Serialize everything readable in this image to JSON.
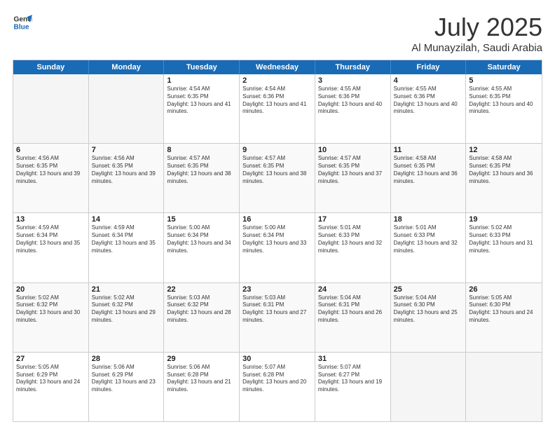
{
  "header": {
    "logo_line1": "General",
    "logo_line2": "Blue",
    "month": "July 2025",
    "location": "Al Munayzilah, Saudi Arabia"
  },
  "weekdays": [
    "Sunday",
    "Monday",
    "Tuesday",
    "Wednesday",
    "Thursday",
    "Friday",
    "Saturday"
  ],
  "rows": [
    [
      {
        "day": "",
        "sunrise": "",
        "sunset": "",
        "daylight": ""
      },
      {
        "day": "",
        "sunrise": "",
        "sunset": "",
        "daylight": ""
      },
      {
        "day": "1",
        "sunrise": "Sunrise: 4:54 AM",
        "sunset": "Sunset: 6:35 PM",
        "daylight": "Daylight: 13 hours and 41 minutes."
      },
      {
        "day": "2",
        "sunrise": "Sunrise: 4:54 AM",
        "sunset": "Sunset: 6:36 PM",
        "daylight": "Daylight: 13 hours and 41 minutes."
      },
      {
        "day": "3",
        "sunrise": "Sunrise: 4:55 AM",
        "sunset": "Sunset: 6:36 PM",
        "daylight": "Daylight: 13 hours and 40 minutes."
      },
      {
        "day": "4",
        "sunrise": "Sunrise: 4:55 AM",
        "sunset": "Sunset: 6:36 PM",
        "daylight": "Daylight: 13 hours and 40 minutes."
      },
      {
        "day": "5",
        "sunrise": "Sunrise: 4:55 AM",
        "sunset": "Sunset: 6:35 PM",
        "daylight": "Daylight: 13 hours and 40 minutes."
      }
    ],
    [
      {
        "day": "6",
        "sunrise": "Sunrise: 4:56 AM",
        "sunset": "Sunset: 6:35 PM",
        "daylight": "Daylight: 13 hours and 39 minutes."
      },
      {
        "day": "7",
        "sunrise": "Sunrise: 4:56 AM",
        "sunset": "Sunset: 6:35 PM",
        "daylight": "Daylight: 13 hours and 39 minutes."
      },
      {
        "day": "8",
        "sunrise": "Sunrise: 4:57 AM",
        "sunset": "Sunset: 6:35 PM",
        "daylight": "Daylight: 13 hours and 38 minutes."
      },
      {
        "day": "9",
        "sunrise": "Sunrise: 4:57 AM",
        "sunset": "Sunset: 6:35 PM",
        "daylight": "Daylight: 13 hours and 38 minutes."
      },
      {
        "day": "10",
        "sunrise": "Sunrise: 4:57 AM",
        "sunset": "Sunset: 6:35 PM",
        "daylight": "Daylight: 13 hours and 37 minutes."
      },
      {
        "day": "11",
        "sunrise": "Sunrise: 4:58 AM",
        "sunset": "Sunset: 6:35 PM",
        "daylight": "Daylight: 13 hours and 36 minutes."
      },
      {
        "day": "12",
        "sunrise": "Sunrise: 4:58 AM",
        "sunset": "Sunset: 6:35 PM",
        "daylight": "Daylight: 13 hours and 36 minutes."
      }
    ],
    [
      {
        "day": "13",
        "sunrise": "Sunrise: 4:59 AM",
        "sunset": "Sunset: 6:34 PM",
        "daylight": "Daylight: 13 hours and 35 minutes."
      },
      {
        "day": "14",
        "sunrise": "Sunrise: 4:59 AM",
        "sunset": "Sunset: 6:34 PM",
        "daylight": "Daylight: 13 hours and 35 minutes."
      },
      {
        "day": "15",
        "sunrise": "Sunrise: 5:00 AM",
        "sunset": "Sunset: 6:34 PM",
        "daylight": "Daylight: 13 hours and 34 minutes."
      },
      {
        "day": "16",
        "sunrise": "Sunrise: 5:00 AM",
        "sunset": "Sunset: 6:34 PM",
        "daylight": "Daylight: 13 hours and 33 minutes."
      },
      {
        "day": "17",
        "sunrise": "Sunrise: 5:01 AM",
        "sunset": "Sunset: 6:33 PM",
        "daylight": "Daylight: 13 hours and 32 minutes."
      },
      {
        "day": "18",
        "sunrise": "Sunrise: 5:01 AM",
        "sunset": "Sunset: 6:33 PM",
        "daylight": "Daylight: 13 hours and 32 minutes."
      },
      {
        "day": "19",
        "sunrise": "Sunrise: 5:02 AM",
        "sunset": "Sunset: 6:33 PM",
        "daylight": "Daylight: 13 hours and 31 minutes."
      }
    ],
    [
      {
        "day": "20",
        "sunrise": "Sunrise: 5:02 AM",
        "sunset": "Sunset: 6:32 PM",
        "daylight": "Daylight: 13 hours and 30 minutes."
      },
      {
        "day": "21",
        "sunrise": "Sunrise: 5:02 AM",
        "sunset": "Sunset: 6:32 PM",
        "daylight": "Daylight: 13 hours and 29 minutes."
      },
      {
        "day": "22",
        "sunrise": "Sunrise: 5:03 AM",
        "sunset": "Sunset: 6:32 PM",
        "daylight": "Daylight: 13 hours and 28 minutes."
      },
      {
        "day": "23",
        "sunrise": "Sunrise: 5:03 AM",
        "sunset": "Sunset: 6:31 PM",
        "daylight": "Daylight: 13 hours and 27 minutes."
      },
      {
        "day": "24",
        "sunrise": "Sunrise: 5:04 AM",
        "sunset": "Sunset: 6:31 PM",
        "daylight": "Daylight: 13 hours and 26 minutes."
      },
      {
        "day": "25",
        "sunrise": "Sunrise: 5:04 AM",
        "sunset": "Sunset: 6:30 PM",
        "daylight": "Daylight: 13 hours and 25 minutes."
      },
      {
        "day": "26",
        "sunrise": "Sunrise: 5:05 AM",
        "sunset": "Sunset: 6:30 PM",
        "daylight": "Daylight: 13 hours and 24 minutes."
      }
    ],
    [
      {
        "day": "27",
        "sunrise": "Sunrise: 5:05 AM",
        "sunset": "Sunset: 6:29 PM",
        "daylight": "Daylight: 13 hours and 24 minutes."
      },
      {
        "day": "28",
        "sunrise": "Sunrise: 5:06 AM",
        "sunset": "Sunset: 6:29 PM",
        "daylight": "Daylight: 13 hours and 23 minutes."
      },
      {
        "day": "29",
        "sunrise": "Sunrise: 5:06 AM",
        "sunset": "Sunset: 6:28 PM",
        "daylight": "Daylight: 13 hours and 21 minutes."
      },
      {
        "day": "30",
        "sunrise": "Sunrise: 5:07 AM",
        "sunset": "Sunset: 6:28 PM",
        "daylight": "Daylight: 13 hours and 20 minutes."
      },
      {
        "day": "31",
        "sunrise": "Sunrise: 5:07 AM",
        "sunset": "Sunset: 6:27 PM",
        "daylight": "Daylight: 13 hours and 19 minutes."
      },
      {
        "day": "",
        "sunrise": "",
        "sunset": "",
        "daylight": ""
      },
      {
        "day": "",
        "sunrise": "",
        "sunset": "",
        "daylight": ""
      }
    ]
  ]
}
